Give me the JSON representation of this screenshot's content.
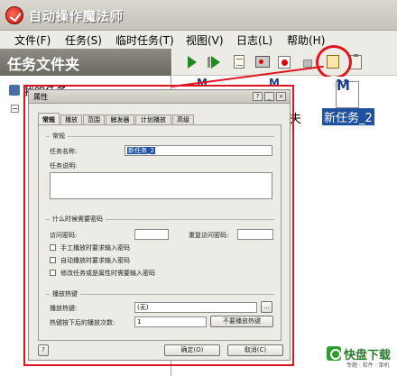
{
  "window": {
    "title": "自动操作魔法师"
  },
  "menu": [
    {
      "label": "文件(F)"
    },
    {
      "label": "任务(S)"
    },
    {
      "label": "临时任务(T)"
    },
    {
      "label": "视图(V)"
    },
    {
      "label": "日志(L)"
    },
    {
      "label": "帮助(H)"
    }
  ],
  "left_panel": {
    "header": "任务文件夹",
    "tree_root": "我的任务",
    "tree_toggle": "−"
  },
  "files": [
    {
      "icon_letter": "M",
      "label": ""
    },
    {
      "icon_letter": "M",
      "label": ""
    },
    {
      "icon_letter": "M",
      "label": "新任务_2",
      "selected": true
    }
  ],
  "clipped_labels": {
    "partial_right": "夫",
    "partial_left": ""
  },
  "dialog": {
    "title": "属性",
    "title_buttons": [
      "?",
      "_",
      "×"
    ],
    "tabs": [
      "常规",
      "播放",
      "范围",
      "触发器",
      "计划播放",
      "高级"
    ],
    "active_tab": 0,
    "section_general": "常规",
    "task_name_label": "任务名称:",
    "task_name_value": "新任务_2",
    "task_desc_label": "任务说明:",
    "section_password": "什么时候需要密码",
    "password_label": "访问密码:",
    "repeat_password_label": "重复访问密码:",
    "checkboxes": [
      "手工播放时要求输入密码",
      "自动播放时要求输入密码",
      "修改任务或是属性时需要输入密码"
    ],
    "section_hotkey": "播放热键",
    "hotkey_label": "播放热键:",
    "hotkey_value": "(无)",
    "browse_button": "...",
    "repeat_count_label": "热键按下后的播放次数:",
    "repeat_count_value": "1",
    "no_hotkey_button": "不要播放热键",
    "help_button": "?",
    "ok_button": "确定(O)",
    "cancel_button": "取消(C)"
  },
  "watermark": {
    "text": "快盘下载",
    "sub": "专题 · 软件 · 单机"
  },
  "colors": {
    "annotation_red": "#e0141e",
    "selection_blue": "#2050a0",
    "title_gradient": "#c5c3ba"
  }
}
